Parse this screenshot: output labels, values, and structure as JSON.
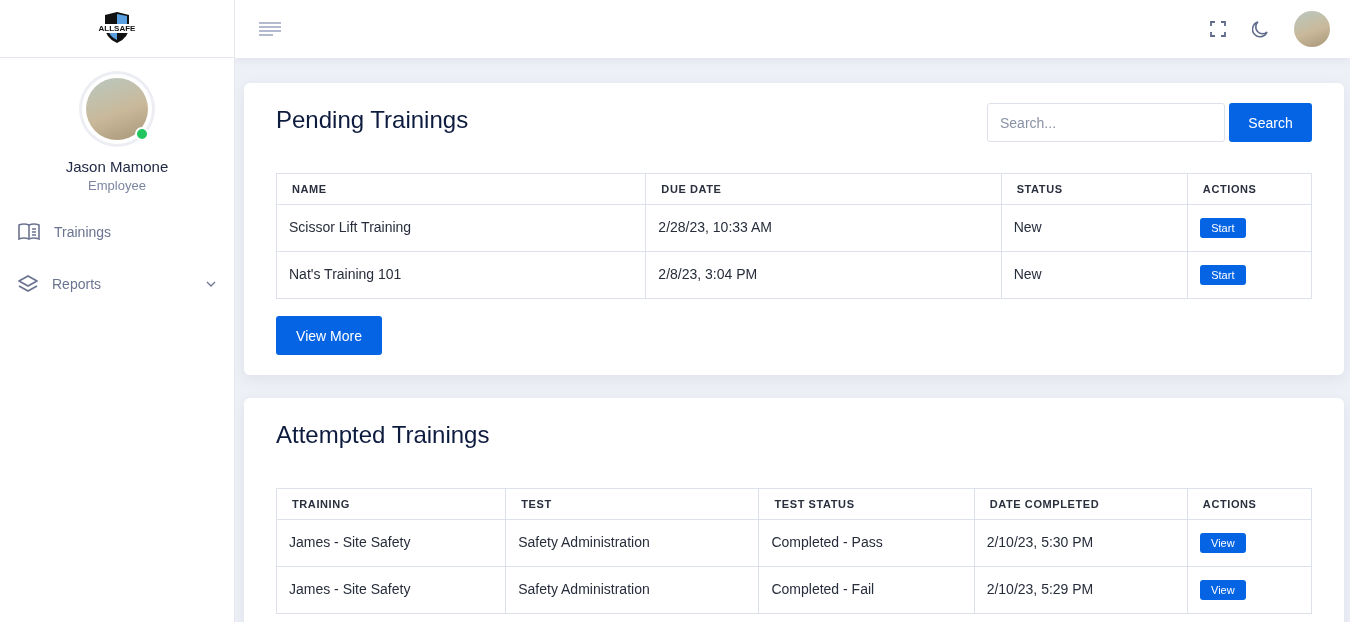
{
  "logo": {
    "text": "ALLSAFE"
  },
  "user": {
    "name": "Jason Mamone",
    "role": "Employee",
    "online": true
  },
  "sidebar": {
    "items": [
      {
        "label": "Trainings"
      },
      {
        "label": "Reports",
        "expanded": false
      }
    ]
  },
  "cards": [
    {
      "title": "Pending Trainings",
      "search": {
        "placeholder": "Search...",
        "button": "Search"
      },
      "columns": [
        "NAME",
        "DUE DATE",
        "STATUS",
        "ACTIONS"
      ],
      "rows": [
        {
          "cells": [
            "Scissor Lift Training",
            "2/28/23, 10:33 AM",
            "New"
          ],
          "action": "Start"
        },
        {
          "cells": [
            "Nat's Training 101",
            "2/8/23, 3:04 PM",
            "New"
          ],
          "action": "Start"
        }
      ],
      "footer_button": "View More"
    },
    {
      "title": "Attempted Trainings",
      "columns": [
        "TRAINING",
        "TEST",
        "TEST STATUS",
        "DATE COMPLETED",
        "ACTIONS"
      ],
      "rows": [
        {
          "cells": [
            "James - Site Safety",
            "Safety Administration",
            "Completed - Pass",
            "2/10/23, 5:30 PM"
          ],
          "action": "View"
        },
        {
          "cells": [
            "James - Site Safety",
            "Safety Administration",
            "Completed - Fail",
            "2/10/23, 5:29 PM"
          ],
          "action": "View"
        }
      ]
    }
  ]
}
